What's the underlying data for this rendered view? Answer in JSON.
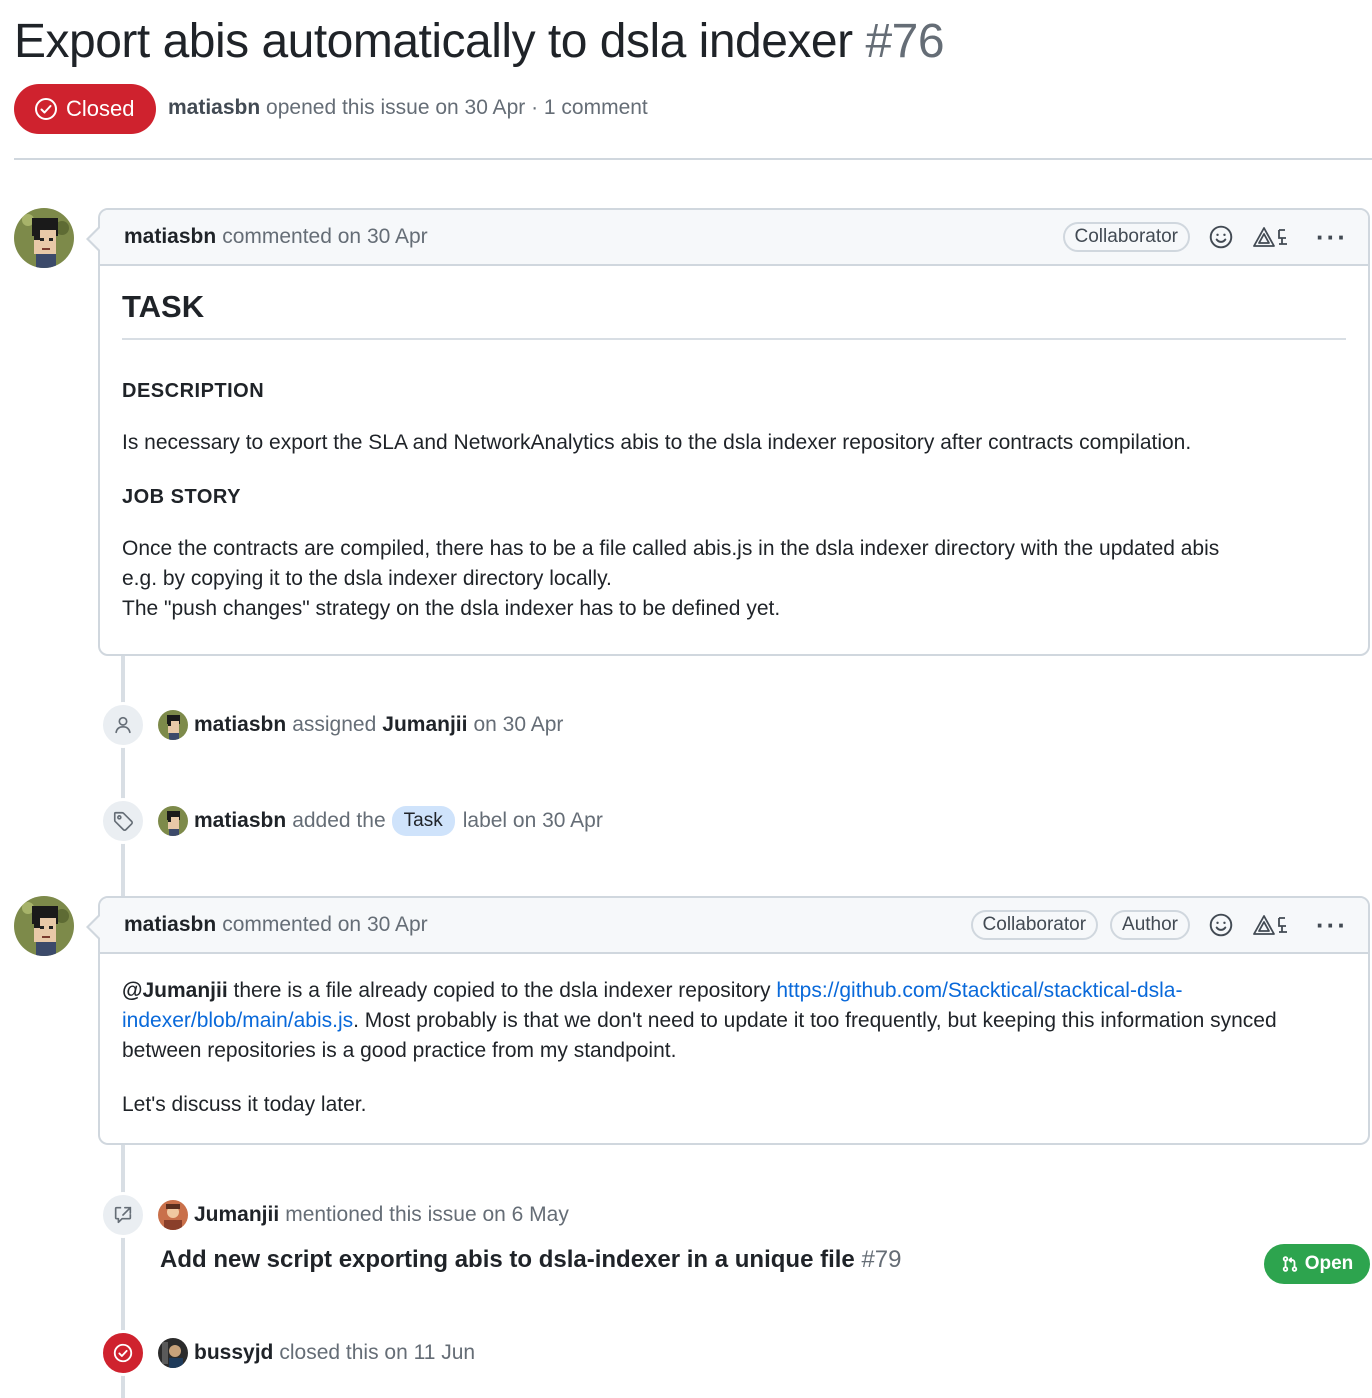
{
  "issue": {
    "title": "Export abis automatically to dsla indexer",
    "number": "#76",
    "state": "Closed",
    "author": "matiasbn",
    "meta_rest": "opened this issue on 30 Apr · 1 comment"
  },
  "comment1": {
    "author": "matiasbn",
    "meta": "commented on 30 Apr",
    "badges": [
      "Collaborator"
    ],
    "heading": "TASK",
    "desc_heading": "DESCRIPTION",
    "desc_text": "Is necessary to export the SLA and NetworkAnalytics abis to the dsla indexer repository after contracts compilation.",
    "story_heading": "JOB STORY",
    "story_line1": "Once the contracts are compiled, there has to be a file called abis.js in the dsla indexer directory with the updated abis",
    "story_line2": "e.g. by copying it to the dsla indexer directory locally.",
    "story_line3": "The \"push changes\" strategy on the dsla indexer has to be defined yet."
  },
  "event_assign": {
    "actor": "matiasbn",
    "verb": "assigned",
    "target": "Jumanjii",
    "when": "on 30 Apr"
  },
  "event_label": {
    "actor": "matiasbn",
    "pre": "added the",
    "label": "Task",
    "post": "label on 30 Apr",
    "label_color": "#cfe3fb"
  },
  "comment2": {
    "author": "matiasbn",
    "meta": "commented on 30 Apr",
    "badge1": "Collaborator",
    "badge2": "Author",
    "mention": "@Jumanjii",
    "text1": " there is a file already copied to the dsla indexer repository ",
    "link": "https://github.com/Stacktical/stacktical-dsla-indexer/blob/main/abis.js",
    "text2": ". Most probably is that we don't need to update it too frequently, but keeping this information synced between repositories is a good practice from my standpoint.",
    "text3": "Let's discuss it today later."
  },
  "event_mention": {
    "actor": "Jumanjii",
    "rest": "mentioned this issue on 6 May",
    "ref_title": "Add new script exporting abis to dsla-indexer in a unique file",
    "ref_number": "#79",
    "ref_state": "Open"
  },
  "event_close": {
    "actor": "bussyjd",
    "rest": "closed this on 11 Jun"
  },
  "icons": {
    "state": "check-circle-icon",
    "emoji": "smiley-icon",
    "report": "triangle-report-icon",
    "more": "kebab-horizontal-icon",
    "assign": "person-icon",
    "label": "tag-icon",
    "mention": "cross-reference-icon",
    "close": "check-circle-icon",
    "pr": "git-pull-request-icon"
  },
  "colors": {
    "closed": "#cf222e",
    "open": "#2da44e",
    "link": "#0969da"
  }
}
